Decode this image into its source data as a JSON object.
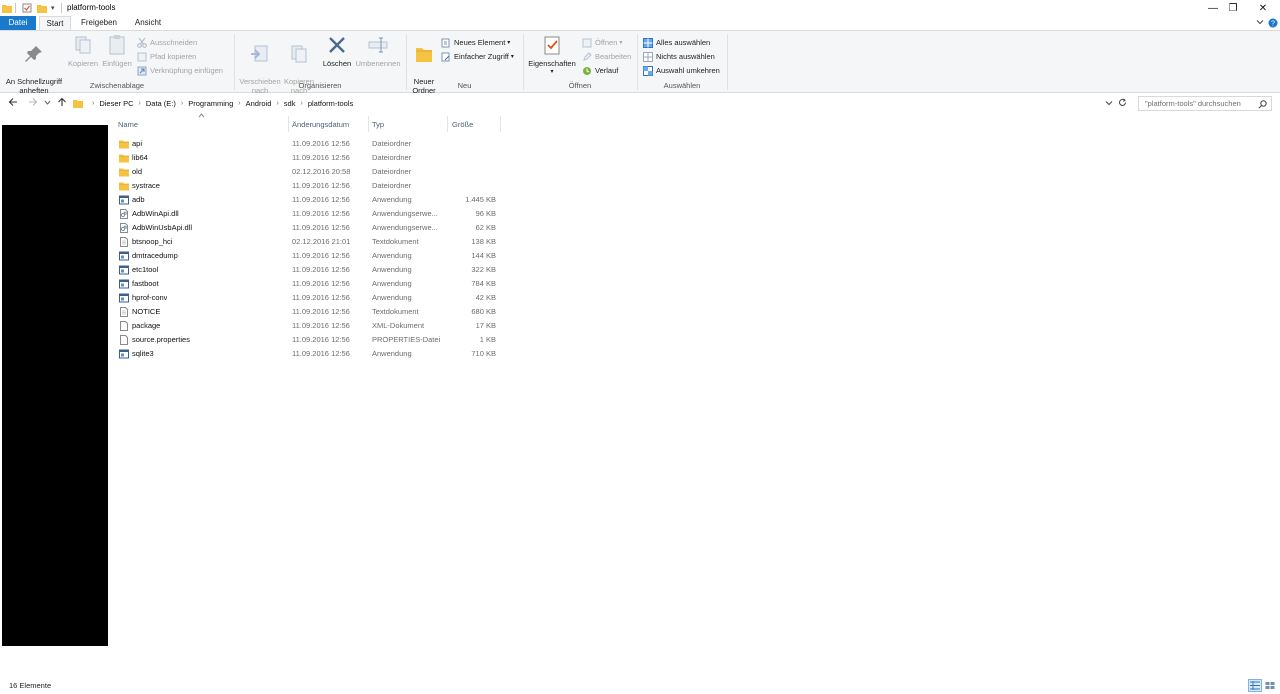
{
  "window": {
    "title": "platform-tools",
    "minimize_glyph": "—",
    "restore_glyph": "❐",
    "close_glyph": "✕",
    "down_arrow": "▾"
  },
  "ribbon_tabs": {
    "file": "Datei",
    "start": "Start",
    "share": "Freigeben",
    "view": "Ansicht"
  },
  "ribbon": {
    "clipboard": {
      "pin": "An Schnellzugriff\nanheften",
      "copy": "Kopieren",
      "paste": "Einfügen",
      "cut": "Ausschneiden",
      "copy_path": "Pfad kopieren",
      "paste_shortcut": "Verknüpfung einfügen",
      "label": "Zwischenablage"
    },
    "organize": {
      "move_to": "Verschieben\nnach",
      "copy_to": "Kopieren\nnach",
      "delete": "Löschen",
      "rename": "Umbenennen",
      "label": "Organisieren"
    },
    "new": {
      "new_folder": "Neuer\nOrdner",
      "new_item": "Neues Element",
      "easy_access": "Einfacher Zugriff",
      "label": "Neu"
    },
    "open": {
      "properties": "Eigenschaften",
      "open": "Öffnen",
      "edit": "Bearbeiten",
      "history": "Verlauf",
      "label": "Öffnen"
    },
    "select": {
      "select_all": "Alles auswählen",
      "select_none": "Nichts auswählen",
      "invert": "Auswahl umkehren",
      "label": "Auswählen"
    }
  },
  "address": {
    "crumbs": [
      "Dieser PC",
      "Data (E:)",
      "Programming",
      "Android",
      "sdk",
      "platform-tools"
    ],
    "search_placeholder": "\"platform-tools\" durchsuchen"
  },
  "columns": {
    "name": "Name",
    "date": "Änderungsdatum",
    "type": "Typ",
    "size": "Größe"
  },
  "files": [
    {
      "name": "api",
      "date": "11.09.2016 12:56",
      "type": "Dateiordner",
      "size": "",
      "icon": "folder-icon"
    },
    {
      "name": "lib64",
      "date": "11.09.2016 12:56",
      "type": "Dateiordner",
      "size": "",
      "icon": "folder-icon"
    },
    {
      "name": "old",
      "date": "02.12.2016 20:58",
      "type": "Dateiordner",
      "size": "",
      "icon": "folder-icon"
    },
    {
      "name": "systrace",
      "date": "11.09.2016 12:56",
      "type": "Dateiordner",
      "size": "",
      "icon": "folder-icon"
    },
    {
      "name": "adb",
      "date": "11.09.2016 12:56",
      "type": "Anwendung",
      "size": "1.445 KB",
      "icon": "application-icon"
    },
    {
      "name": "AdbWinApi.dll",
      "date": "11.09.2016 12:56",
      "type": "Anwendungserwe...",
      "size": "96 KB",
      "icon": "dll-icon"
    },
    {
      "name": "AdbWinUsbApi.dll",
      "date": "11.09.2016 12:56",
      "type": "Anwendungserwe...",
      "size": "62 KB",
      "icon": "dll-icon"
    },
    {
      "name": "btsnoop_hci",
      "date": "02.12.2016 21:01",
      "type": "Textdokument",
      "size": "138 KB",
      "icon": "text-file-icon"
    },
    {
      "name": "dmtracedump",
      "date": "11.09.2016 12:56",
      "type": "Anwendung",
      "size": "144 KB",
      "icon": "application-icon"
    },
    {
      "name": "etc1tool",
      "date": "11.09.2016 12:56",
      "type": "Anwendung",
      "size": "322 KB",
      "icon": "application-icon"
    },
    {
      "name": "fastboot",
      "date": "11.09.2016 12:56",
      "type": "Anwendung",
      "size": "784 KB",
      "icon": "application-icon"
    },
    {
      "name": "hprof-conv",
      "date": "11.09.2016 12:56",
      "type": "Anwendung",
      "size": "42 KB",
      "icon": "application-icon"
    },
    {
      "name": "NOTICE",
      "date": "11.09.2016 12:56",
      "type": "Textdokument",
      "size": "680 KB",
      "icon": "text-file-icon"
    },
    {
      "name": "package",
      "date": "11.09.2016 12:56",
      "type": "XML-Dokument",
      "size": "17 KB",
      "icon": "blank-file-icon"
    },
    {
      "name": "source.properties",
      "date": "11.09.2016 12:56",
      "type": "PROPERTIES-Datei",
      "size": "1 KB",
      "icon": "blank-file-icon"
    },
    {
      "name": "sqlite3",
      "date": "11.09.2016 12:56",
      "type": "Anwendung",
      "size": "710 KB",
      "icon": "application-icon"
    }
  ],
  "status": {
    "count": "16 Elemente"
  },
  "colors": {
    "accent": "#1979ca",
    "folder": "#f5c242",
    "ribbon_bg": "#f5f6f7",
    "redacted_pane": "#000000"
  }
}
